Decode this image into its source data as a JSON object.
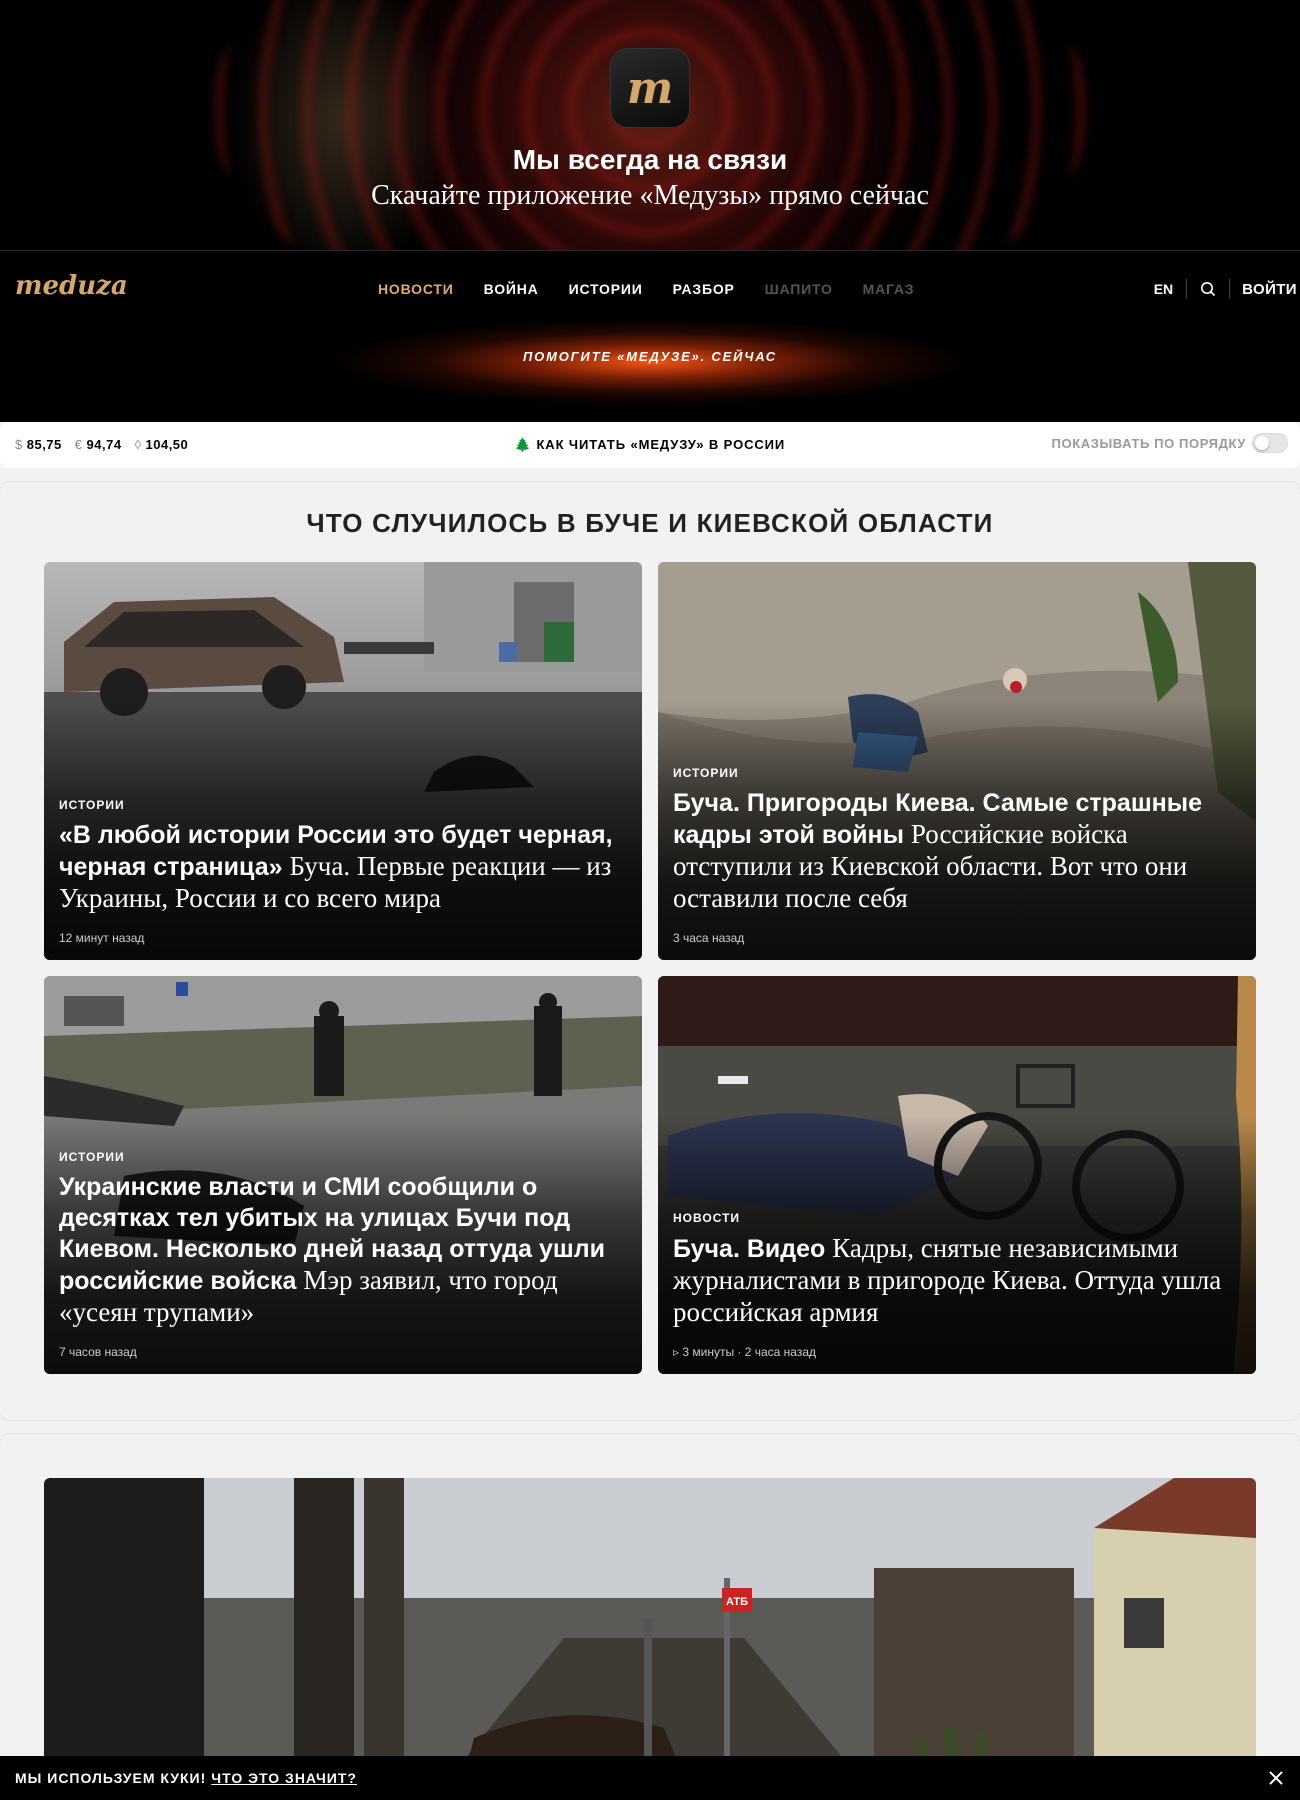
{
  "app_banner": {
    "icon_letter": "m",
    "title": "Мы всегда на связи",
    "subtitle": "Скачайте приложение «Медузы» прямо сейчас"
  },
  "header": {
    "logo": "meduza",
    "nav": [
      {
        "label": "Новости",
        "state": "active"
      },
      {
        "label": "Война",
        "state": "normal"
      },
      {
        "label": "Истории",
        "state": "normal"
      },
      {
        "label": "Разбор",
        "state": "normal"
      },
      {
        "label": "Шапито",
        "state": "dim"
      },
      {
        "label": "Магаз",
        "state": "dim"
      }
    ],
    "lang": "EN",
    "search_icon": "search-icon",
    "login": "ВОЙТИ",
    "donate": "ПОМОГИТЕ «МЕДУЗЕ». СЕЙЧАС"
  },
  "ticker": {
    "rates": [
      {
        "symbol": "$",
        "value": "85,75"
      },
      {
        "symbol": "€",
        "value": "94,74"
      },
      {
        "symbol": "◊",
        "value": "104,50"
      }
    ],
    "how_to_icon": "🌲",
    "how_to": "КАК ЧИТАТЬ «МЕДУЗУ» В РОССИИ",
    "order_label": "ПОКАЗЫВАТЬ ПО ПОРЯДКУ",
    "order_toggle_on": false
  },
  "section": {
    "title": "ЧТО СЛУЧИЛОСЬ В БУЧЕ И КИЕВСКОЙ ОБЛАСТИ",
    "cards": [
      {
        "tag": "ИСТОРИИ",
        "headline_strong": "«В любой истории России это будет черная, черная страница»",
        "headline_light": "Буча. Первые реакции — из Украины, России и со всего мира",
        "meta": "12 минут назад"
      },
      {
        "tag": "ИСТОРИИ",
        "headline_strong": "Буча. Пригороды Киева. Самые страшные кадры этой войны",
        "headline_light": "Российские войска отступили из Киевской области. Вот что они оставили после себя",
        "meta": "3 часа назад"
      },
      {
        "tag": "ИСТОРИИ",
        "headline_strong": "Украинские власти и СМИ сообщили о десятках тел убитых на улицах Бучи под Киевом. Несколько дней назад оттуда ушли российские войска",
        "headline_light": "Мэр заявил, что город «усеян трупами»",
        "meta": "7 часов назад"
      },
      {
        "tag": "НОВОСТИ",
        "headline_strong": "Буча. Видео",
        "headline_light": "Кадры, снятые независимыми журналистами в пригороде Киева. Оттуда ушла российская армия",
        "meta": "▹ 3 минуты · 2 часа назад"
      }
    ]
  },
  "photo_sign": "АТБ",
  "cookie": {
    "message": "МЫ ИСПОЛЬЗУЕМ КУКИ!",
    "link": "ЧТО ЭТО ЗНАЧИТ?",
    "close_icon": "close-icon"
  }
}
